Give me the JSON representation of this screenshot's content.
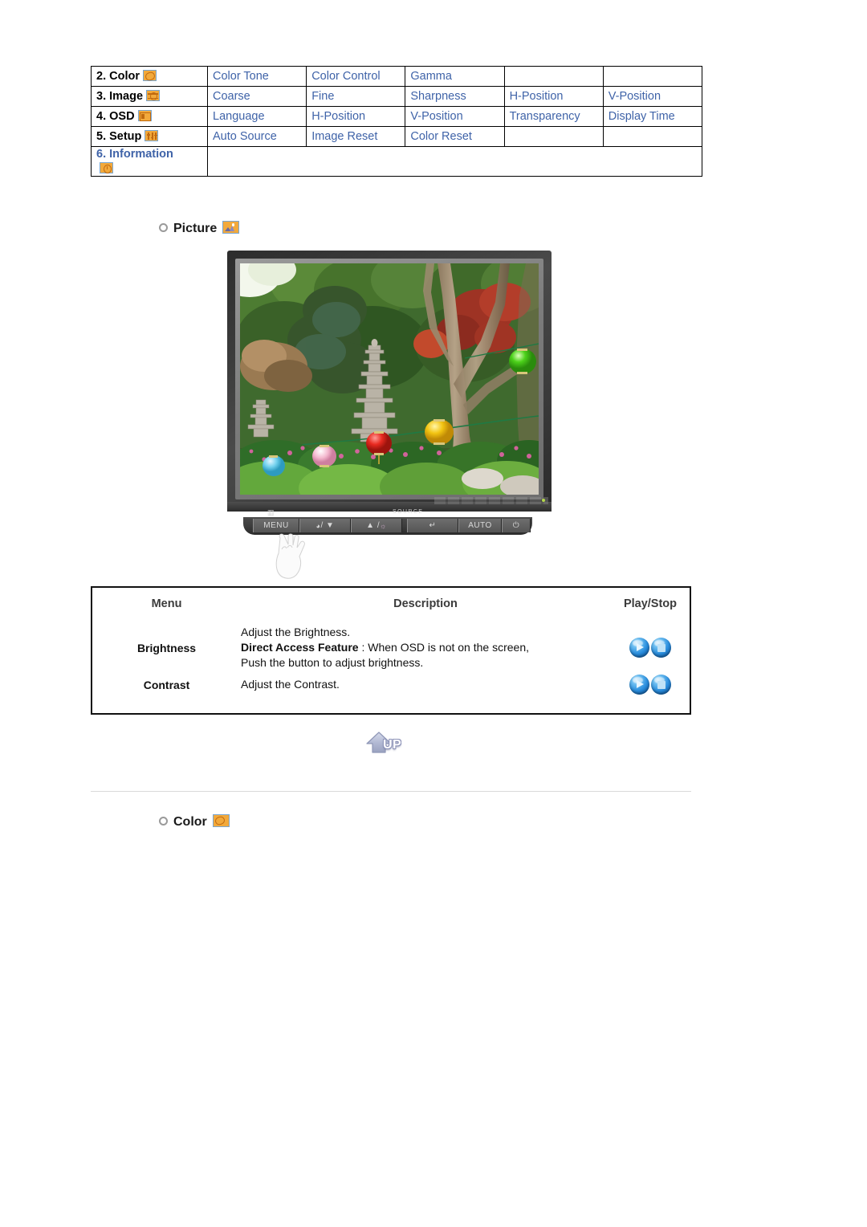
{
  "osd_menu_table": {
    "rows": [
      {
        "label": "2. Color",
        "icon": "color-palette-icon",
        "items": [
          "Color Tone",
          "Color Control",
          "Gamma"
        ]
      },
      {
        "label": "3. Image",
        "icon": "image-adjust-icon",
        "items": [
          "Coarse",
          "Fine",
          "Sharpness",
          "H-Position",
          "V-Position"
        ]
      },
      {
        "label": "4. OSD",
        "icon": "osd-window-icon",
        "items": [
          "Language",
          "H-Position",
          "V-Position",
          "Transparency",
          "Display Time"
        ]
      },
      {
        "label": "5. Setup",
        "icon": "setup-sliders-icon",
        "items": [
          "Auto Source",
          "Image Reset",
          "Color Reset"
        ]
      },
      {
        "label": "6. Information",
        "icon": "information-clock-icon",
        "items": []
      }
    ],
    "link_color": "#3f63a8",
    "label_color": "#000000"
  },
  "picture_section": {
    "heading": "Picture",
    "icon": "picture-thumbnail-icon"
  },
  "color_section": {
    "heading": "Color",
    "icon": "color-palette-icon"
  },
  "monitor": {
    "alt": "LCD monitor displaying a garden photo with a stone pagoda, trees and colorful paper lanterns",
    "source_label": "SOURCE",
    "buttons": [
      {
        "name": "menu-button",
        "label": "MENU"
      },
      {
        "name": "brightness-down-button",
        "label": "/ ▼"
      },
      {
        "name": "brightness-up-button",
        "label": "▲ /"
      },
      {
        "name": "source-enter-button",
        "label": "↵"
      },
      {
        "name": "auto-button",
        "label": "AUTO"
      },
      {
        "name": "power-button",
        "label": "⏻"
      }
    ]
  },
  "description_table": {
    "headers": {
      "menu": "Menu",
      "description": "Description",
      "play_stop": "Play/Stop"
    },
    "rows": [
      {
        "menu": "Brightness",
        "desc_line1": "Adjust the Brightness.",
        "desc_bold": "Direct Access Feature",
        "desc_line2": " : When OSD is not on the screen,",
        "desc_line3": "Push the button to adjust brightness.",
        "play_label": "play",
        "stop_label": "stop"
      },
      {
        "menu": "Contrast",
        "desc_line1": "Adjust the Contrast.",
        "desc_bold": "",
        "desc_line2": "",
        "desc_line3": "",
        "play_label": "play",
        "stop_label": "stop"
      }
    ]
  },
  "up_button": {
    "label": "UP",
    "icon": "up-arrow-icon"
  }
}
